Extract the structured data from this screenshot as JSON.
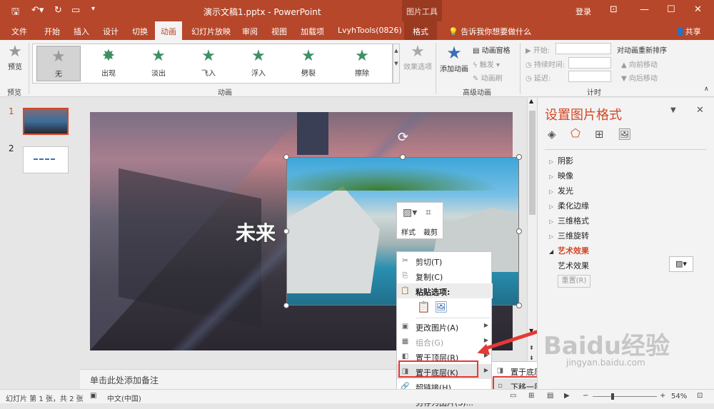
{
  "window": {
    "title": "演示文稿1.pptx - PowerPoint",
    "context_tab_group": "图片工具",
    "login": "登录"
  },
  "tabs": [
    "文件",
    "开始",
    "插入",
    "设计",
    "切换",
    "动画",
    "幻灯片放映",
    "审阅",
    "视图",
    "加载项",
    "LvyhTools(0826)",
    "格式"
  ],
  "active_tab": "动画",
  "tell_me": "告诉我你想要做什么",
  "share": "共享",
  "ribbon": {
    "preview": {
      "label": "预览",
      "group": "预览"
    },
    "animations": [
      "无",
      "出现",
      "淡出",
      "飞入",
      "浮入",
      "劈裂",
      "擦除"
    ],
    "animation_group": "动画",
    "effect_options": "效果选项",
    "add_animation": "添加动画",
    "anim_pane": "动画窗格",
    "trigger": "触发",
    "anim_painter": "动画刷",
    "advanced_group": "高级动画",
    "start_label": "开始:",
    "duration_label": "持续时间:",
    "delay_label": "延迟:",
    "reorder_title": "对动画重新排序",
    "move_earlier": "向前移动",
    "move_later": "向后移动",
    "timing_group": "计时"
  },
  "slides": [
    {
      "number": "1"
    },
    {
      "number": "2"
    }
  ],
  "slide": {
    "title_text": "未来"
  },
  "mini_toolbar": {
    "style": "样式",
    "crop": "裁剪"
  },
  "context_menu": [
    {
      "label": "剪切(T)",
      "icon": "✂",
      "disabled": false,
      "arrow": ""
    },
    {
      "label": "复制(C)",
      "icon": "⎘",
      "disabled": false,
      "arrow": ""
    },
    {
      "label": "粘贴选项:",
      "icon": "📋",
      "disabled": false,
      "arrow": ""
    },
    {
      "label": "",
      "icon": "",
      "disabled": false,
      "arrow": ""
    },
    {
      "label": "更改图片(A)",
      "icon": "▣",
      "disabled": false,
      "arrow": "▶"
    },
    {
      "label": "组合(G)",
      "icon": "▦",
      "disabled": true,
      "arrow": "▶"
    },
    {
      "label": "置于顶层(R)",
      "icon": "◧",
      "disabled": false,
      "arrow": "▶"
    },
    {
      "label": "置于底层(K)",
      "icon": "◨",
      "disabled": false,
      "arrow": "▶"
    },
    {
      "label": "超链接(H)...",
      "icon": "🔗",
      "disabled": false,
      "arrow": ""
    },
    {
      "label": "另存为图片(S)...",
      "icon": "",
      "disabled": false,
      "arrow": ""
    }
  ],
  "submenu": [
    {
      "label": "置于底层(K)"
    },
    {
      "label": "下移一层(B)"
    }
  ],
  "notes_placeholder": "单击此处添加备注",
  "format_pane": {
    "title": "设置图片格式",
    "items": [
      "阴影",
      "映像",
      "发光",
      "柔化边缘",
      "三维格式",
      "三维旋转",
      "艺术效果"
    ],
    "expanded_item": "艺术效果",
    "art_effect_label": "艺术效果",
    "reset": "重置(R)"
  },
  "status": {
    "slide_info": "幻灯片 第 1 张，共 2 张",
    "language": "中文(中国)",
    "zoom": "54%"
  },
  "watermark": {
    "brand": "Baidu经验",
    "url": "jingyan.baidu.com"
  },
  "colors": {
    "accent": "#b7472a",
    "pane_title": "#d24726",
    "annotation": "#e53935"
  }
}
